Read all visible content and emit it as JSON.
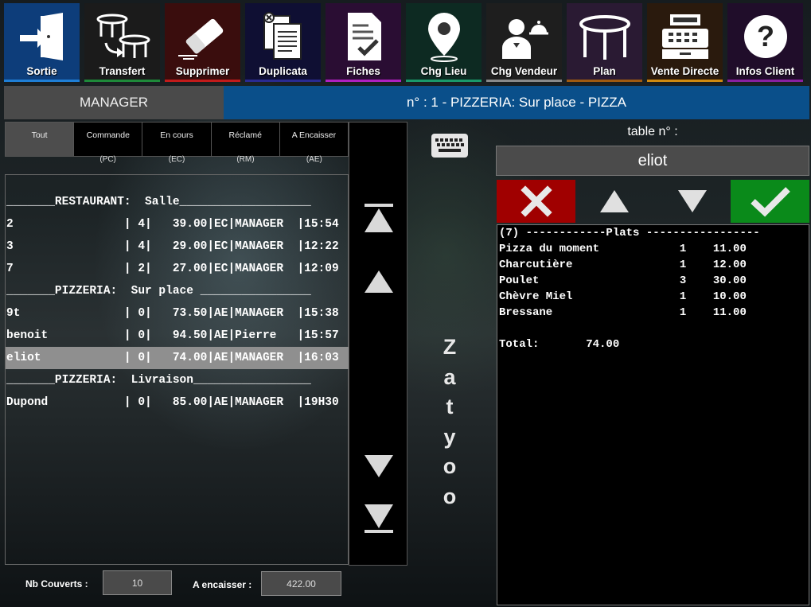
{
  "toolbar": {
    "buttons": [
      {
        "label": "Sortie",
        "icon": "exit-door-icon",
        "accent": "#1f7fd6",
        "bg": "#0d3d7a"
      },
      {
        "label": "Transfert",
        "icon": "transfer-tables-icon",
        "accent": "#1e8a3a",
        "bg": "#1b1b1b"
      },
      {
        "label": "Supprimer",
        "icon": "eraser-icon",
        "accent": "#c21b1b",
        "bg": "#3a0d0d"
      },
      {
        "label": "Duplicata",
        "icon": "duplicate-docs-icon",
        "accent": "#2a2a90",
        "bg": "#0f0f33"
      },
      {
        "label": "Fiches",
        "icon": "checklist-icon",
        "accent": "#b020c0",
        "bg": "#2a0d33"
      },
      {
        "label": "Chg Lieu",
        "icon": "location-pin-icon",
        "accent": "#1a9a6a",
        "bg": "#0d2a22"
      },
      {
        "label": "Chg Vendeur",
        "icon": "waiter-icon",
        "accent": "#8a8a8a",
        "bg": "#1e1e1e"
      },
      {
        "label": "Plan",
        "icon": "table-icon",
        "accent": "#a05a10",
        "bg": "#2a1a33"
      },
      {
        "label": "Vente Directe",
        "icon": "cash-register-icon",
        "accent": "#d08a10",
        "bg": "#2a1a0d"
      },
      {
        "label": "Infos Client",
        "icon": "question-icon",
        "accent": "#8a20a0",
        "bg": "#200d2a"
      }
    ]
  },
  "header": {
    "user": "MANAGER",
    "order_info": "n° : 1 - PIZZERIA: Sur place  - PIZZA"
  },
  "filters": {
    "tabs": [
      {
        "label": "Tout",
        "code": ""
      },
      {
        "label": "Commande",
        "code": "(PC)"
      },
      {
        "label": "En cours",
        "code": "(EC)"
      },
      {
        "label": "Réclamé",
        "code": "(RM)"
      },
      {
        "label": "A Encaisser",
        "code": "(AE)"
      }
    ],
    "active": "Tout"
  },
  "orders": [
    {
      "text": "_______RESTAURANT:  Salle___________________",
      "type": "header"
    },
    {
      "text": "2                | 4|   39.00|EC|MANAGER  |15:54",
      "type": "row"
    },
    {
      "text": "3                | 4|   29.00|EC|MANAGER  |12:22",
      "type": "row"
    },
    {
      "text": "7                | 2|   27.00|EC|MANAGER  |12:09",
      "type": "row"
    },
    {
      "text": "_______PIZZERIA:  Sur place ________________",
      "type": "header"
    },
    {
      "text": "9t               | 0|   73.50|AE|MANAGER  |15:38",
      "type": "row"
    },
    {
      "text": "benoit           | 0|   94.50|AE|Pierre   |15:57",
      "type": "row"
    },
    {
      "text": "eliot            | 0|   74.00|AE|MANAGER  |16:03",
      "type": "selected"
    },
    {
      "text": "_______PIZZERIA:  Livraison_________________",
      "type": "header"
    },
    {
      "text": "Dupond           | 0|   85.00|AE|MANAGER  |19H30",
      "type": "row"
    }
  ],
  "brand_letters": [
    "Z",
    "a",
    "t",
    "y",
    "o",
    "o"
  ],
  "footer": {
    "covers_label": "Nb Couverts :",
    "covers_value": "10",
    "to_collect_label": "A encaisser :",
    "to_collect_value": "422.00"
  },
  "table_panel": {
    "label": "table  n° :",
    "value": "eliot",
    "cancel_color": "#a00000",
    "confirm_color": "#0a8a1a"
  },
  "ticket": {
    "lines": [
      "(7) ------------Plats -----------------",
      "Pizza du moment            1    11.00",
      "Charcutière                1    12.00",
      "Poulet                     3    30.00",
      "Chèvre Miel                1    10.00",
      "Bressane                   1    11.00",
      "",
      "Total:       74.00"
    ]
  }
}
